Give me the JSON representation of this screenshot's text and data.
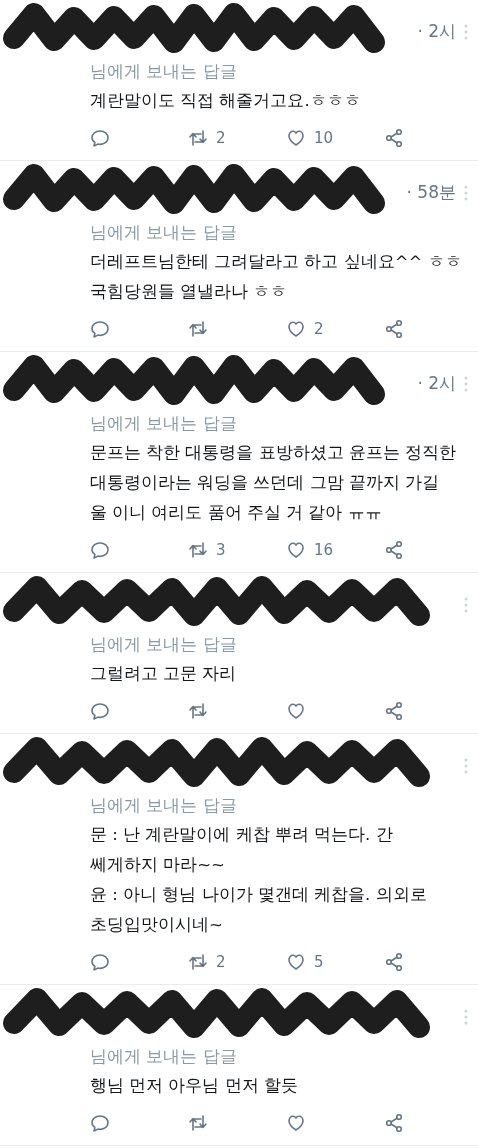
{
  "replies": [
    {
      "time": "· 2시",
      "reply_to": "님에게 보내는 답글",
      "lines": [
        "계란말이도 직접 해줄거고요.ㅎㅎㅎ"
      ],
      "retweets": "2",
      "likes": "10"
    },
    {
      "time": "· 58분",
      "reply_to": "님에게 보내는 답글",
      "lines": [
        "더레프트님한테 그려달라고 하고 싶네요^^ ㅎㅎ",
        "국힘당원들 열낼라나 ㅎㅎ"
      ],
      "likes": "2"
    },
    {
      "time": "· 2시",
      "reply_to": "님에게 보내는 답글",
      "lines": [
        "문프는 착한 대통령을 표방하셨고 윤프는 정직한",
        "대통령이라는 워딩을 쓰던데 그맘 끝까지 가길",
        "울 이니 여리도 품어 주실 거 같아 ㅠㅠ"
      ],
      "retweets": "3",
      "likes": "16"
    },
    {
      "reply_to": "님에게 보내는 답글",
      "lines": [
        "그럴려고 고문 자리"
      ]
    },
    {
      "reply_to": "님에게 보내는 답글",
      "lines": [
        "문 : 난 계란말이에 케찹 뿌려 먹는다. 간",
        "쎄게하지 마라~~",
        "윤 : 아니 형님 나이가 몇갠데 케찹을. 의외로",
        "초딩입맛이시네~"
      ],
      "retweets": "2",
      "likes": "5"
    },
    {
      "reply_to": "님에게 보내는 답글",
      "lines": [
        "행님 먼저 아우님 먼저 할듯"
      ]
    }
  ]
}
